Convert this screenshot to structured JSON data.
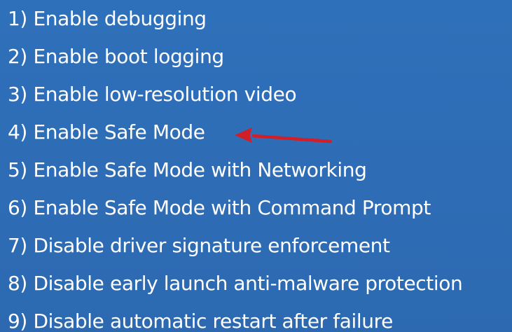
{
  "startup_settings": {
    "options": [
      {
        "label": "1) Enable debugging"
      },
      {
        "label": "2) Enable boot logging"
      },
      {
        "label": "3) Enable low-resolution video"
      },
      {
        "label": "4) Enable Safe Mode"
      },
      {
        "label": "5) Enable Safe Mode with Networking"
      },
      {
        "label": "6) Enable Safe Mode with Command Prompt"
      },
      {
        "label": "7) Disable driver signature enforcement"
      },
      {
        "label": "8) Disable early launch anti-malware protection"
      },
      {
        "label": "9) Disable automatic restart after failure"
      }
    ]
  },
  "annotation": {
    "arrow_icon": "red-arrow-left-icon",
    "arrow_color": "#d11f2a",
    "points_to_option": 4
  },
  "colors": {
    "background": "#2f6eb8",
    "text": "#ffffff"
  }
}
